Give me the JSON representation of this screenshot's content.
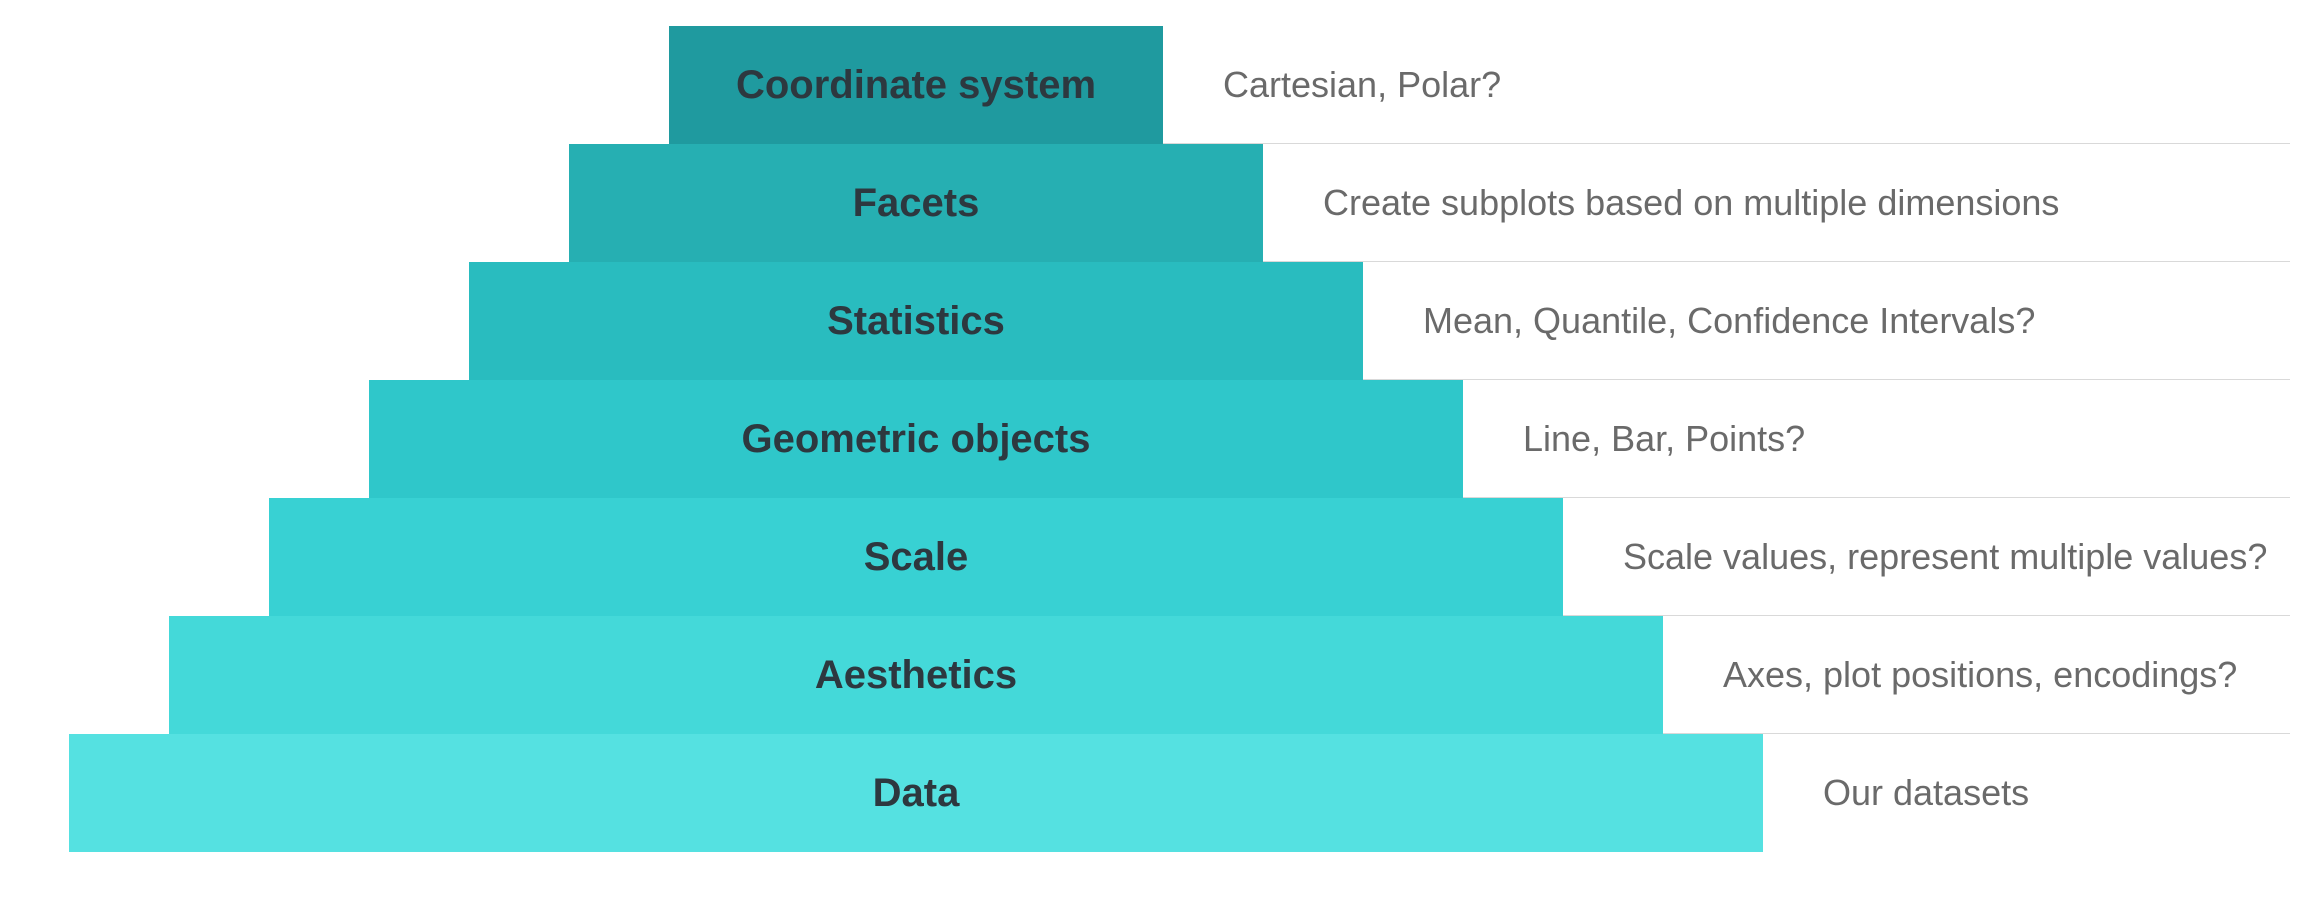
{
  "diagram": {
    "type": "layered-pyramid",
    "layers": [
      {
        "label": "Coordinate system",
        "description": "Cartesian, Polar?",
        "color": "#1f9a9f"
      },
      {
        "label": "Facets",
        "description": "Create subplots based on multiple dimensions",
        "color": "#26afb2"
      },
      {
        "label": "Statistics",
        "description": "Mean, Quantile, Confidence Intervals?",
        "color": "#29bcbf"
      },
      {
        "label": "Geometric objects",
        "description": "Line, Bar, Points?",
        "color": "#2fc7ca"
      },
      {
        "label": "Scale",
        "description": "Scale values, represent multiple values?",
        "color": "#38d1d3"
      },
      {
        "label": "Aesthetics",
        "description": "Axes, plot positions, encodings?",
        "color": "#44d9d9"
      },
      {
        "label": "Data",
        "description": "Our datasets",
        "color": "#55e1e1"
      }
    ]
  }
}
